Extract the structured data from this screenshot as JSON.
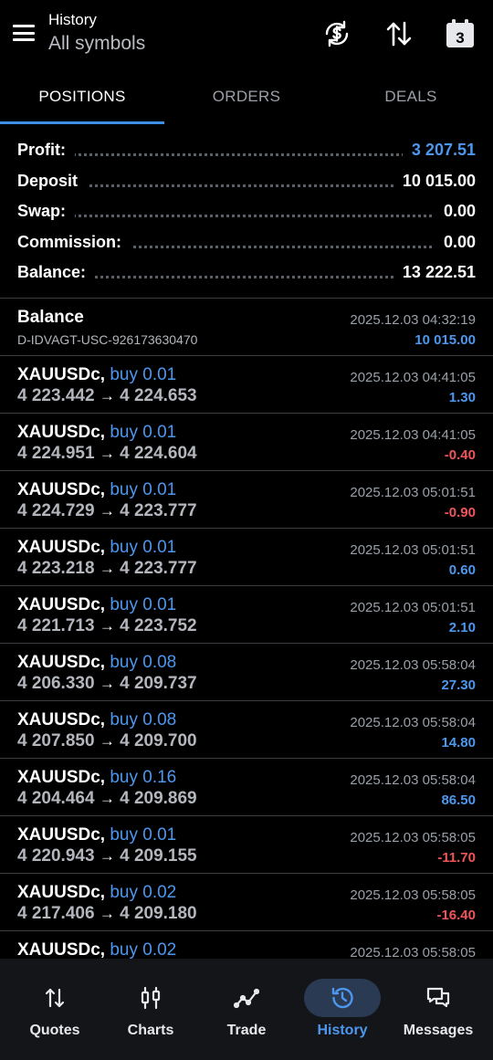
{
  "header": {
    "subtitle": "History",
    "title": "All symbols",
    "calendar_day": "3",
    "icons": [
      "menu-icon",
      "currency-refresh-icon",
      "sort-icon",
      "calendar-icon"
    ]
  },
  "tabs": [
    {
      "label": "POSITIONS",
      "active": true
    },
    {
      "label": "ORDERS",
      "active": false
    },
    {
      "label": "DEALS",
      "active": false
    }
  ],
  "summary": [
    {
      "label": "Profit:",
      "value": "3 207.51",
      "highlight": true
    },
    {
      "label": "Deposit",
      "value": "10 015.00",
      "highlight": false
    },
    {
      "label": "Swap:",
      "value": "0.00",
      "highlight": false
    },
    {
      "label": "Commission:",
      "value": "0.00",
      "highlight": false
    },
    {
      "label": "Balance:",
      "value": "13 222.51",
      "highlight": false
    }
  ],
  "balance_entry": {
    "title": "Balance",
    "account": "D-IDVAGT-USC-926173630470",
    "time": "2025.12.03 04:32:19",
    "amount": "10 015.00"
  },
  "positions": [
    {
      "symbol": "XAUUSDc,",
      "side": "buy 0.01",
      "open": "4 223.442",
      "arrow": "→",
      "close": "4 224.653",
      "time": "2025.12.03 04:41:05",
      "profit": "1.30",
      "sign": "pos"
    },
    {
      "symbol": "XAUUSDc,",
      "side": "buy 0.01",
      "open": "4 224.951",
      "arrow": "→",
      "close": "4 224.604",
      "time": "2025.12.03 04:41:05",
      "profit": "-0.40",
      "sign": "neg"
    },
    {
      "symbol": "XAUUSDc,",
      "side": "buy 0.01",
      "open": "4 224.729",
      "arrow": "→",
      "close": "4 223.777",
      "time": "2025.12.03 05:01:51",
      "profit": "-0.90",
      "sign": "neg"
    },
    {
      "symbol": "XAUUSDc,",
      "side": "buy 0.01",
      "open": "4 223.218",
      "arrow": "→",
      "close": "4 223.777",
      "time": "2025.12.03 05:01:51",
      "profit": "0.60",
      "sign": "pos"
    },
    {
      "symbol": "XAUUSDc,",
      "side": "buy 0.01",
      "open": "4 221.713",
      "arrow": "→",
      "close": "4 223.752",
      "time": "2025.12.03 05:01:51",
      "profit": "2.10",
      "sign": "pos"
    },
    {
      "symbol": "XAUUSDc,",
      "side": "buy 0.08",
      "open": "4 206.330",
      "arrow": "→",
      "close": "4 209.737",
      "time": "2025.12.03 05:58:04",
      "profit": "27.30",
      "sign": "pos"
    },
    {
      "symbol": "XAUUSDc,",
      "side": "buy 0.08",
      "open": "4 207.850",
      "arrow": "→",
      "close": "4 209.700",
      "time": "2025.12.03 05:58:04",
      "profit": "14.80",
      "sign": "pos"
    },
    {
      "symbol": "XAUUSDc,",
      "side": "buy 0.16",
      "open": "4 204.464",
      "arrow": "→",
      "close": "4 209.869",
      "time": "2025.12.03 05:58:04",
      "profit": "86.50",
      "sign": "pos"
    },
    {
      "symbol": "XAUUSDc,",
      "side": "buy 0.01",
      "open": "4 220.943",
      "arrow": "→",
      "close": "4 209.155",
      "time": "2025.12.03 05:58:05",
      "profit": "-11.70",
      "sign": "neg"
    },
    {
      "symbol": "XAUUSDc,",
      "side": "buy 0.02",
      "open": "4 217.406",
      "arrow": "→",
      "close": "4 209.180",
      "time": "2025.12.03 05:58:05",
      "profit": "-16.40",
      "sign": "neg"
    },
    {
      "symbol": "XAUUSDc,",
      "side": "buy 0.02",
      "open": "",
      "arrow": "",
      "close": "",
      "time": "2025.12.03 05:58:05",
      "profit": "",
      "sign": "pos"
    }
  ],
  "colors": {
    "accent": "#4d97ef",
    "negative": "#f0555a",
    "background": "#000000",
    "nav_background": "#141518"
  },
  "bottom_nav": [
    {
      "label": "Quotes",
      "icon": "quotes-icon",
      "active": false
    },
    {
      "label": "Charts",
      "icon": "candlestick-icon",
      "active": false
    },
    {
      "label": "Trade",
      "icon": "trade-line-icon",
      "active": false
    },
    {
      "label": "History",
      "icon": "history-icon",
      "active": true
    },
    {
      "label": "Messages",
      "icon": "messages-icon",
      "active": false
    }
  ]
}
